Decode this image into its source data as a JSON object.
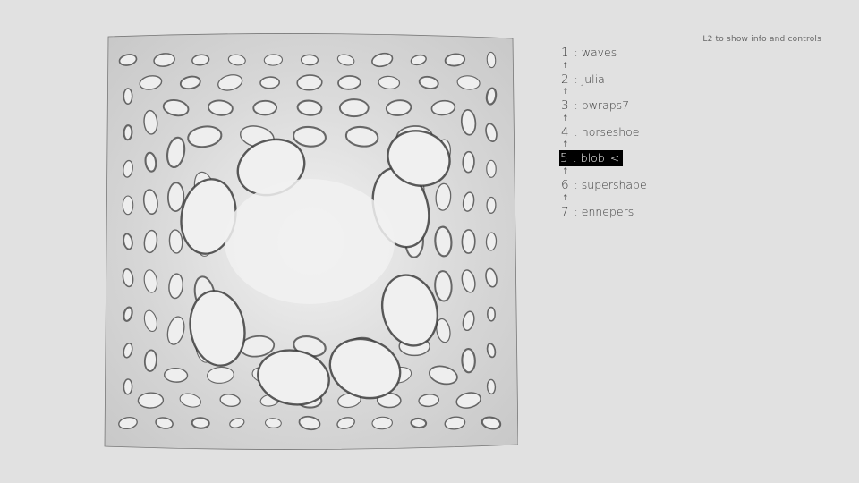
{
  "app": {
    "hint": "L2 to show info and controls"
  },
  "render": {
    "description": "flame fractal render - blob variation",
    "background": "#ebebeb",
    "ink": "#3c3c3c"
  },
  "menu": {
    "arrow_glyph": "↑",
    "active_marker": "<",
    "items": [
      {
        "num": "1",
        "sep": " : ",
        "label": "waves",
        "active": false
      },
      {
        "num": "2",
        "sep": " : ",
        "label": "julia",
        "active": false
      },
      {
        "num": "3",
        "sep": " : ",
        "label": "bwraps7",
        "active": false
      },
      {
        "num": "4",
        "sep": " : ",
        "label": "horseshoe",
        "active": false
      },
      {
        "num": "5",
        "sep": " : ",
        "label": "blob",
        "active": true
      },
      {
        "num": "6",
        "sep": " : ",
        "label": "supershape",
        "active": false
      },
      {
        "num": "7",
        "sep": " : ",
        "label": "ennepers",
        "active": false
      }
    ]
  },
  "colors": {
    "page_bg": "#e1e1e1",
    "text": "#3a3a3a",
    "highlight_bg": "#000000",
    "highlight_text": "#ffffff"
  }
}
